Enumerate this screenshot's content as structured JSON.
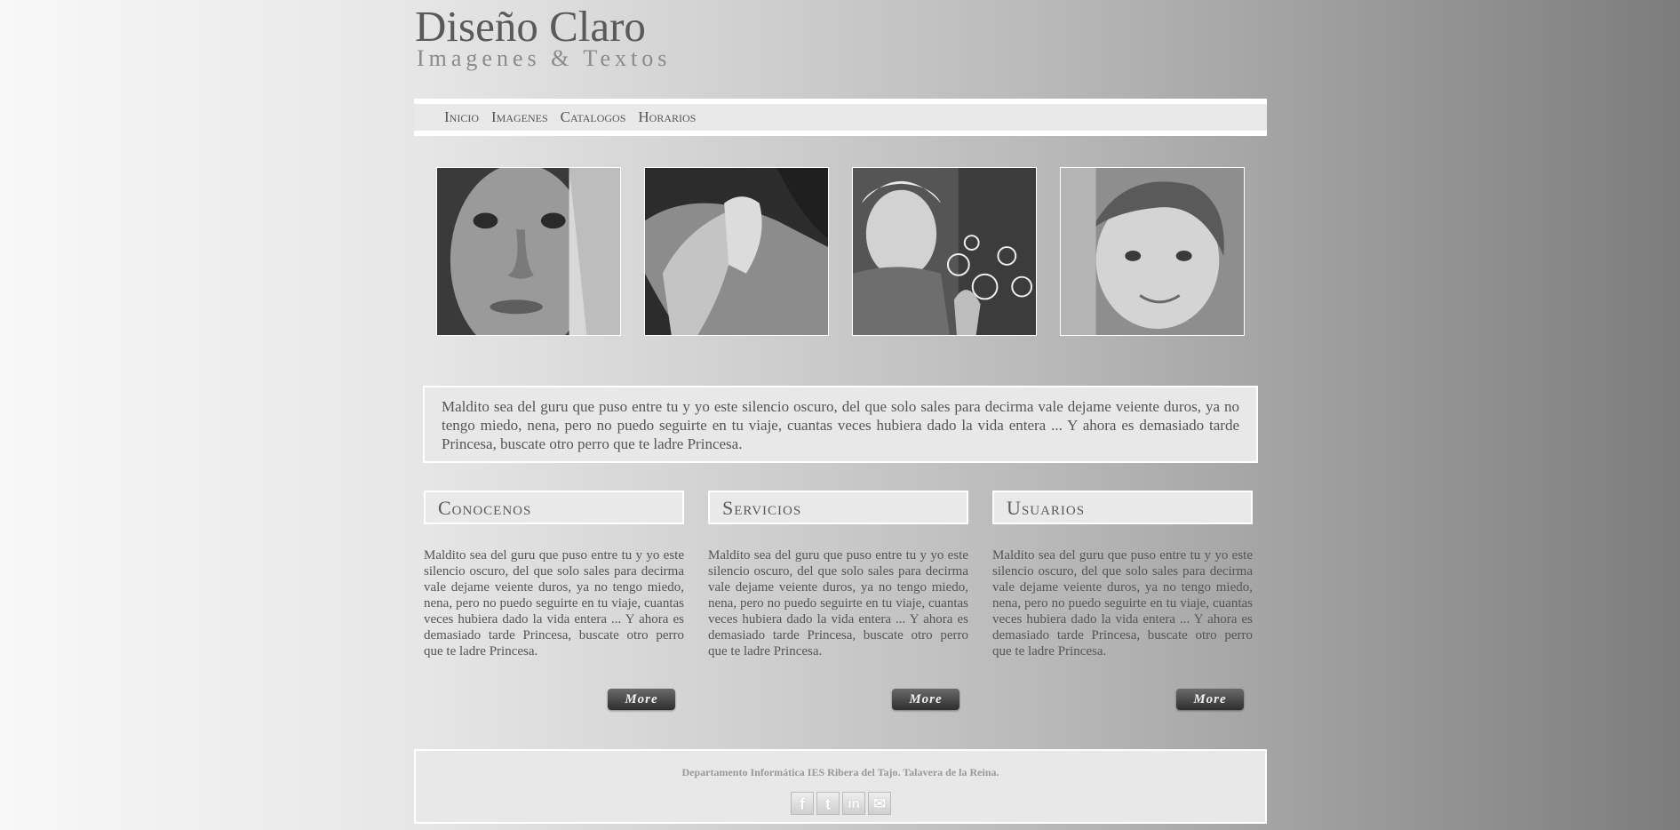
{
  "header": {
    "title": "Diseño Claro",
    "subtitle": "Imagenes & Textos"
  },
  "nav": [
    {
      "label": "Inicio"
    },
    {
      "label": "Imagenes"
    },
    {
      "label": "Catalogos"
    },
    {
      "label": "Horarios"
    }
  ],
  "gallery": [
    {
      "subject": "child-face"
    },
    {
      "subject": "hands"
    },
    {
      "subject": "child-bubbles"
    },
    {
      "subject": "smiling-child"
    }
  ],
  "intro": {
    "text": "Maldito sea del guru que puso entre tu y yo este silencio oscuro, del que solo sales para decirma vale dejame veiente duros, ya no tengo miedo, nena, pero no puedo seguirte en tu viaje, cuantas veces hubiera dado la vida entera ... Y ahora es demasiado tarde Princesa, buscate otro perro que te ladre Princesa."
  },
  "columns": [
    {
      "title": "Conocenos",
      "text": "Maldito sea del guru que puso entre tu y yo este silencio oscuro, del que solo sales para decirma vale dejame veiente duros, ya no tengo miedo, nena, pero no puedo seguirte en tu viaje, cuantas veces hubiera dado la vida entera ... Y ahora es demasiado tarde Princesa, buscate otro perro que te ladre Princesa.",
      "button": "More"
    },
    {
      "title": "Servicios",
      "text": "Maldito sea del guru que puso entre tu y yo este silencio oscuro, del que solo sales para decirma vale dejame veiente duros, ya no tengo miedo, nena, pero no puedo seguirte en tu viaje, cuantas veces hubiera dado la vida entera ... Y ahora es demasiado tarde Princesa, buscate otro perro que te ladre Princesa.",
      "button": "More"
    },
    {
      "title": "Usuarios",
      "text": "Maldito sea del guru que puso entre tu y yo este silencio oscuro, del que solo sales para decirma vale dejame veiente duros, ya no tengo miedo, nena, pero no puedo seguirte en tu viaje, cuantas veces hubiera dado la vida entera ... Y ahora es demasiado tarde Princesa, buscate otro perro que te ladre Princesa.",
      "button": "More"
    }
  ],
  "footer": {
    "text": "Departamento Informática IES Ribera del Tajo. Talavera de la Reina.",
    "social": [
      {
        "icon": "facebook-icon",
        "glyph": "f"
      },
      {
        "icon": "twitter-icon",
        "glyph": "t"
      },
      {
        "icon": "linkedin-icon",
        "glyph": "in"
      },
      {
        "icon": "mail-icon",
        "glyph": "✉"
      }
    ]
  }
}
